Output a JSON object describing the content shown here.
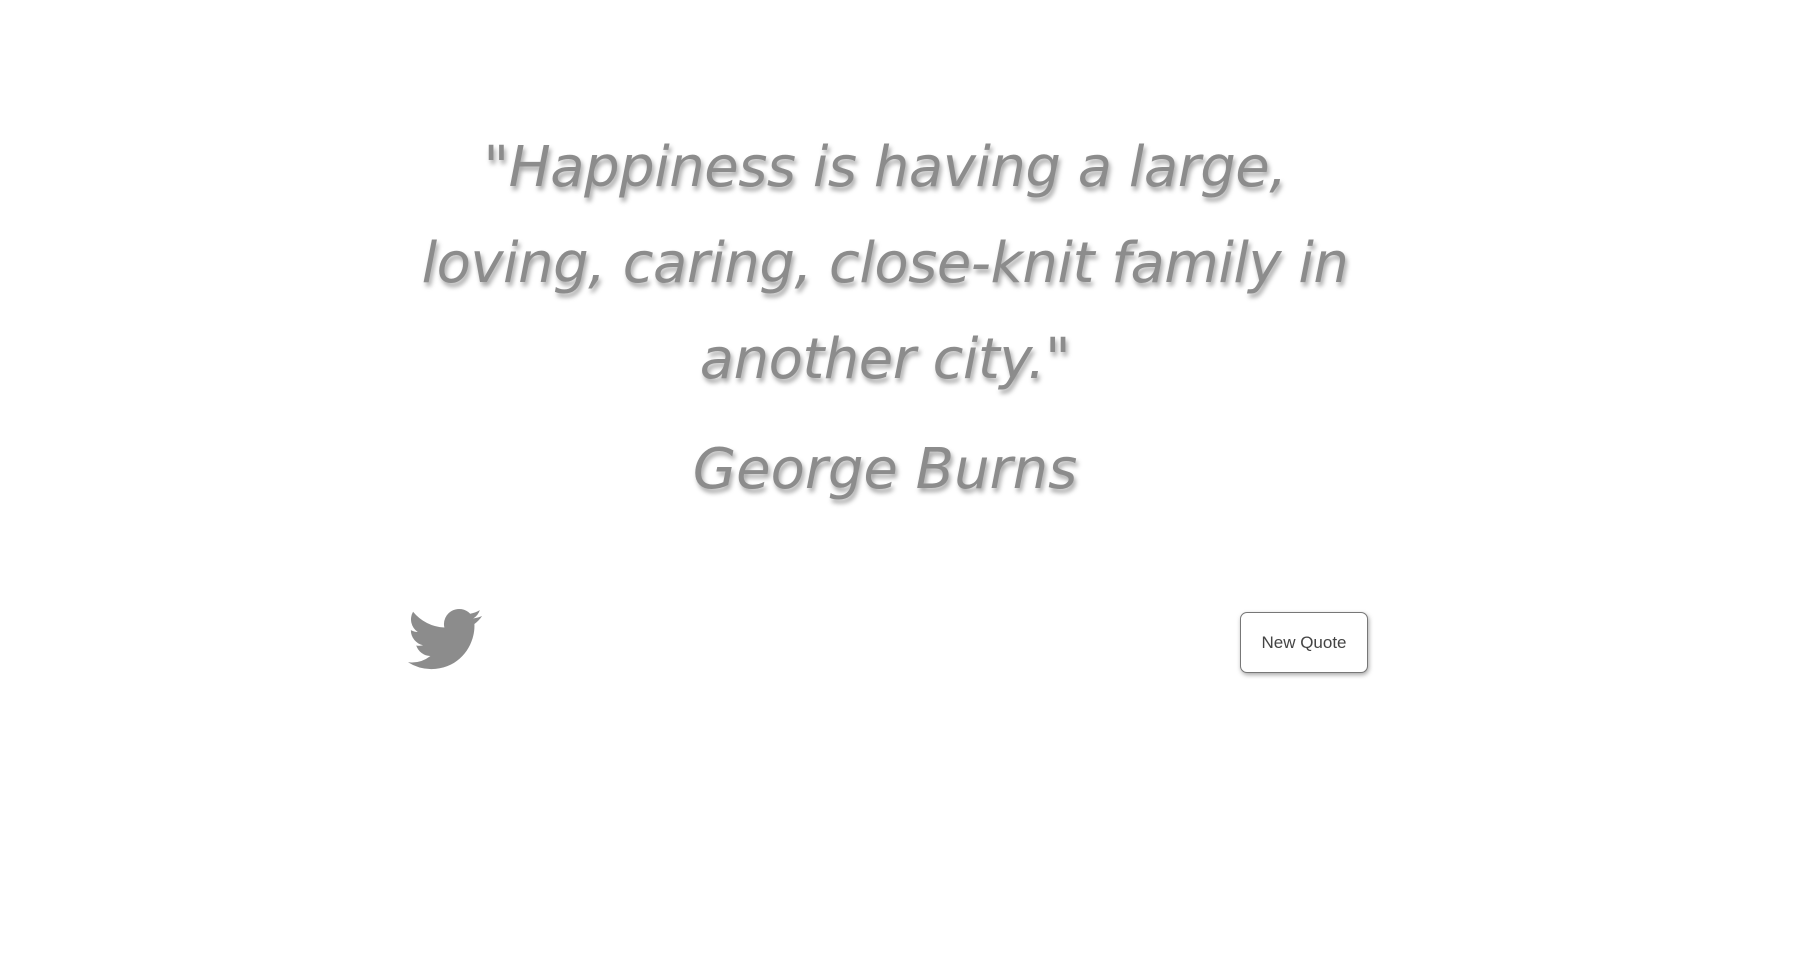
{
  "quote": {
    "text": "\"Happiness is having a large, loving, caring, close-knit family in another city.\"",
    "author": "George Burns"
  },
  "actions": {
    "tweet_icon": "twitter-bird-icon",
    "new_quote_label": "New Quote"
  },
  "colors": {
    "text": "#8c8c8c",
    "icon": "#8c8c8c",
    "button_border": "#777777",
    "background": "#ffffff"
  }
}
